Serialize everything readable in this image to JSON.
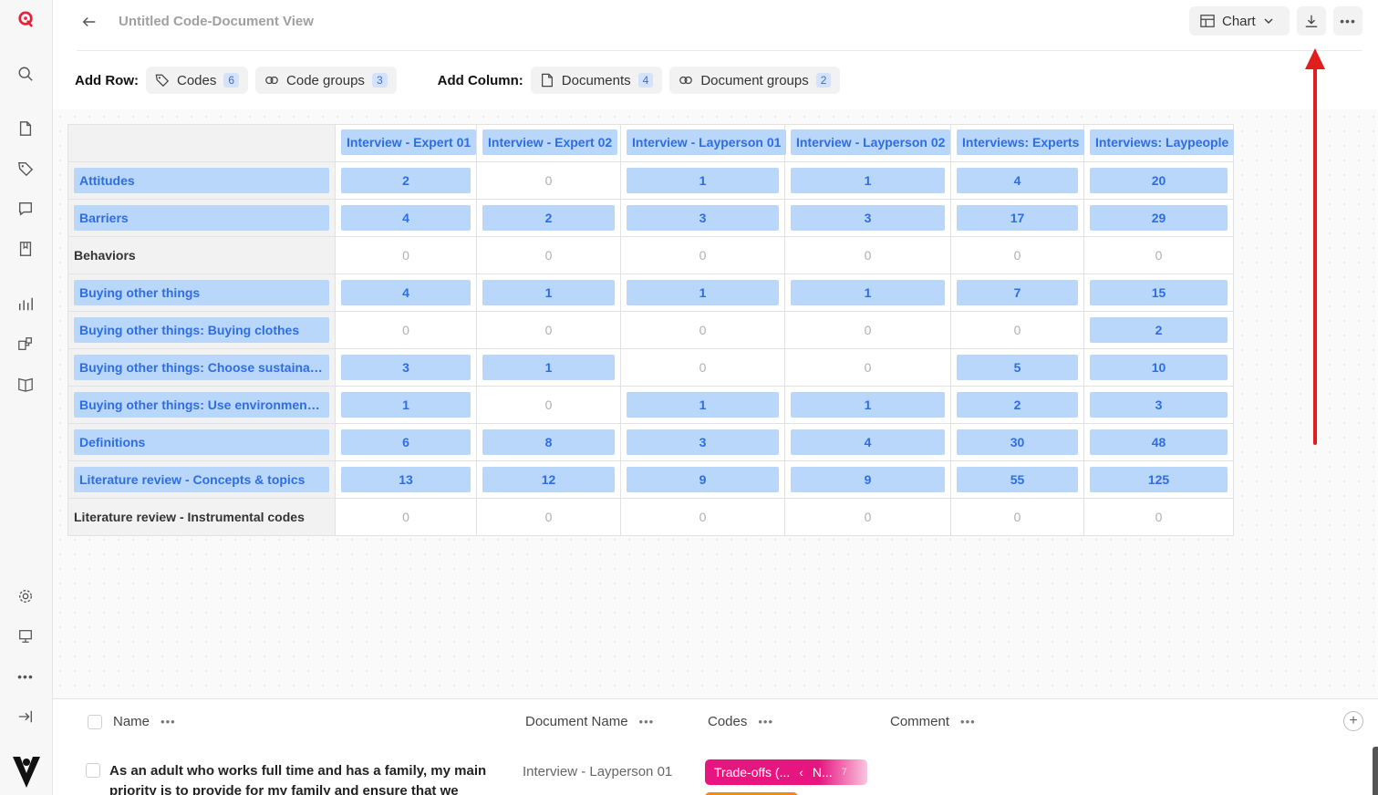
{
  "header": {
    "title": "Untitled Code-Document View",
    "chart_label": "Chart"
  },
  "addbar": {
    "row_label": "Add Row:",
    "column_label": "Add Column:",
    "chips": [
      {
        "label": "Codes",
        "count": "6"
      },
      {
        "label": "Code groups",
        "count": "3"
      },
      {
        "label": "Documents",
        "count": "4"
      },
      {
        "label": "Document groups",
        "count": "2"
      }
    ]
  },
  "matrix": {
    "columns": [
      "Interview - Expert 01",
      "Interview - Expert 02",
      "Interview - Layperson 01",
      "Interview - Layperson 02",
      "Interviews: Experts",
      "Interviews: Laypeople"
    ],
    "rows": [
      {
        "label": "Attitudes",
        "highlight": true,
        "values": [
          "2",
          "0",
          "1",
          "1",
          "4",
          "20"
        ]
      },
      {
        "label": "Barriers",
        "highlight": true,
        "values": [
          "4",
          "2",
          "3",
          "3",
          "17",
          "29"
        ]
      },
      {
        "label": "Behaviors",
        "highlight": false,
        "values": [
          "0",
          "0",
          "0",
          "0",
          "0",
          "0"
        ]
      },
      {
        "label": "Buying other things",
        "highlight": true,
        "values": [
          "4",
          "1",
          "1",
          "1",
          "7",
          "15"
        ]
      },
      {
        "label": "Buying other things: Buying clothes",
        "highlight": true,
        "values": [
          "0",
          "0",
          "0",
          "0",
          "0",
          "2"
        ]
      },
      {
        "label": "Buying other things: Choose sustainabl...",
        "highlight": true,
        "values": [
          "3",
          "1",
          "0",
          "0",
          "5",
          "10"
        ]
      },
      {
        "label": "Buying other things: Use environmentall...",
        "highlight": true,
        "values": [
          "1",
          "0",
          "1",
          "1",
          "2",
          "3"
        ]
      },
      {
        "label": "Definitions",
        "highlight": true,
        "values": [
          "6",
          "8",
          "3",
          "4",
          "30",
          "48"
        ]
      },
      {
        "label": "Literature review - Concepts & topics",
        "highlight": true,
        "values": [
          "13",
          "12",
          "9",
          "9",
          "55",
          "125"
        ]
      },
      {
        "label": "Literature review - Instrumental codes",
        "highlight": false,
        "values": [
          "0",
          "0",
          "0",
          "0",
          "0",
          "0"
        ]
      }
    ]
  },
  "list": {
    "headers": {
      "name": "Name",
      "document": "Document Name",
      "codes": "Codes",
      "comment": "Comment"
    },
    "row": {
      "text": "As an adult who works full time and has a family, my main priority is to provide for my family and ensure that we have a",
      "document": "Interview - Layperson 01",
      "code": "Trade-offs (...",
      "code_sub": "N...",
      "code_count": "7"
    }
  },
  "colors": {
    "accent_blue": "#2f6ee0",
    "tag_bg": "#b9d6fb",
    "brand_red": "#e8203a",
    "arrow_red": "#e01e1e",
    "code_pink": "#e6157f",
    "code_orange": "#f08a1c"
  }
}
